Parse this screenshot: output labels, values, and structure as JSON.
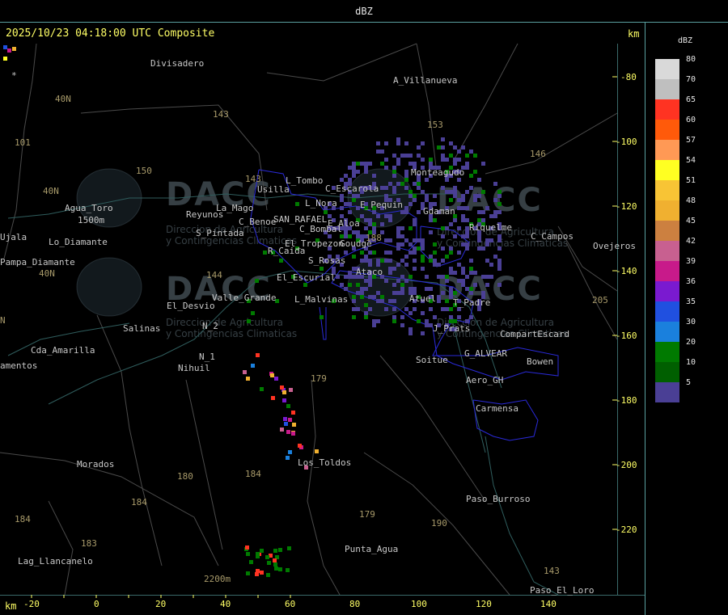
{
  "header": {
    "title": "dBZ"
  },
  "timestamp": "2025/10/23 04:18:00 UTC Composite",
  "axis_unit_top": "km",
  "axis_unit_bottom": "km",
  "x_axis": {
    "ticks": [
      "-20",
      "0",
      "20",
      "40",
      "60",
      "80",
      "100",
      "120",
      "140"
    ]
  },
  "y_axis": {
    "ticks": [
      "-80",
      "-100",
      "-120",
      "-140",
      "-160",
      "-180",
      "-200",
      "-220"
    ]
  },
  "legend": {
    "title": "dBZ",
    "entries": [
      {
        "label": "80",
        "color": "#d9d9d9"
      },
      {
        "label": "70",
        "color": "#bfbfbf"
      },
      {
        "label": "65",
        "color": "#ff3322"
      },
      {
        "label": "60",
        "color": "#ff5a0a"
      },
      {
        "label": "57",
        "color": "#ff9955"
      },
      {
        "label": "54",
        "color": "#ffff22"
      },
      {
        "label": "51",
        "color": "#f8c435"
      },
      {
        "label": "48",
        "color": "#f0b030"
      },
      {
        "label": "45",
        "color": "#cc8040"
      },
      {
        "label": "42",
        "color": "#c86090"
      },
      {
        "label": "39",
        "color": "#c81a8a"
      },
      {
        "label": "36",
        "color": "#7a1ad0"
      },
      {
        "label": "35",
        "color": "#2050e0"
      },
      {
        "label": "30",
        "color": "#1a80dd"
      },
      {
        "label": "20",
        "color": "#007a00"
      },
      {
        "label": "10",
        "color": "#005f00"
      },
      {
        "label": "5",
        "color": "#4a3f95"
      }
    ]
  },
  "watermark": {
    "brand": "DACC",
    "line1": "Direccion de Agricultura",
    "line2": "y Contingencias Climaticas"
  },
  "places": [
    "Divisadero",
    "A_Villanueva",
    "Agua_Toro",
    "1500m",
    "Pampa_Diamante",
    "Lo_Diamante",
    "Ujala",
    "Usilla",
    "L_Tombo",
    "C_Escarola",
    "L_Nora",
    "E_Pequin",
    "Reyunos",
    "La_Mago",
    "C_Benoe",
    "SAN_RAFAEL",
    "E_Aloa",
    "C_Bombal",
    "S_Pintada",
    "El_Tropezon",
    "Goudge",
    "R_Caida",
    "S_Rosas",
    "Ataco",
    "Atuel",
    "El_Escurial",
    "Valle_Grande",
    "L_Malvinas",
    "El_Desvio",
    "Salinas",
    "N_2",
    "N_1",
    "Nihuil",
    "Cda_Amarilla",
    "amentos",
    "Monteagudo",
    "Gdaman",
    "Riquelme",
    "C_Campos",
    "Ovejeros",
    "T_Padre",
    "J_Prats",
    "CompartEscard",
    "G_ALVEAR",
    "Soitue",
    "Bowen",
    "Aero_GH",
    "Carmensa",
    "Morados",
    "Los_Toldos",
    "Paso_Burroso",
    "Punta_Agua",
    "Lag_Llancanelo",
    "2200m",
    "Paso_El_Loro"
  ],
  "routes": [
    "143",
    "101",
    "40N",
    "150",
    "40N",
    "144",
    "153",
    "146",
    "143",
    "179",
    "184",
    "188",
    "184",
    "180",
    "184",
    "183",
    "179",
    "190",
    "143",
    "205",
    "40N",
    "N"
  ],
  "marker": "*"
}
